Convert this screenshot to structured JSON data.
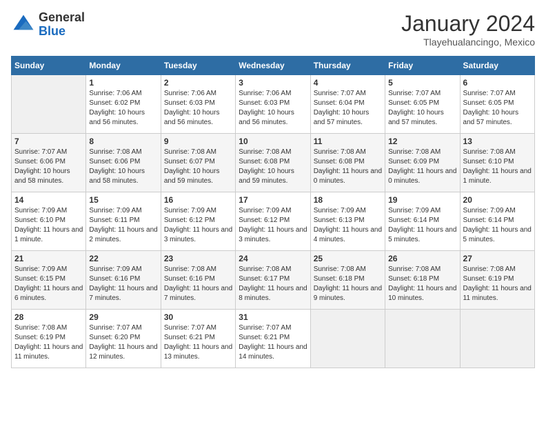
{
  "header": {
    "logo_line1": "General",
    "logo_line2": "Blue",
    "month": "January 2024",
    "location": "Tlayehualancingo, Mexico"
  },
  "days_of_week": [
    "Sunday",
    "Monday",
    "Tuesday",
    "Wednesday",
    "Thursday",
    "Friday",
    "Saturday"
  ],
  "weeks": [
    [
      {
        "day": "",
        "sunrise": "",
        "sunset": "",
        "daylight": ""
      },
      {
        "day": "1",
        "sunrise": "Sunrise: 7:06 AM",
        "sunset": "Sunset: 6:02 PM",
        "daylight": "Daylight: 10 hours and 56 minutes."
      },
      {
        "day": "2",
        "sunrise": "Sunrise: 7:06 AM",
        "sunset": "Sunset: 6:03 PM",
        "daylight": "Daylight: 10 hours and 56 minutes."
      },
      {
        "day": "3",
        "sunrise": "Sunrise: 7:06 AM",
        "sunset": "Sunset: 6:03 PM",
        "daylight": "Daylight: 10 hours and 56 minutes."
      },
      {
        "day": "4",
        "sunrise": "Sunrise: 7:07 AM",
        "sunset": "Sunset: 6:04 PM",
        "daylight": "Daylight: 10 hours and 57 minutes."
      },
      {
        "day": "5",
        "sunrise": "Sunrise: 7:07 AM",
        "sunset": "Sunset: 6:05 PM",
        "daylight": "Daylight: 10 hours and 57 minutes."
      },
      {
        "day": "6",
        "sunrise": "Sunrise: 7:07 AM",
        "sunset": "Sunset: 6:05 PM",
        "daylight": "Daylight: 10 hours and 57 minutes."
      }
    ],
    [
      {
        "day": "7",
        "sunrise": "Sunrise: 7:07 AM",
        "sunset": "Sunset: 6:06 PM",
        "daylight": "Daylight: 10 hours and 58 minutes."
      },
      {
        "day": "8",
        "sunrise": "Sunrise: 7:08 AM",
        "sunset": "Sunset: 6:06 PM",
        "daylight": "Daylight: 10 hours and 58 minutes."
      },
      {
        "day": "9",
        "sunrise": "Sunrise: 7:08 AM",
        "sunset": "Sunset: 6:07 PM",
        "daylight": "Daylight: 10 hours and 59 minutes."
      },
      {
        "day": "10",
        "sunrise": "Sunrise: 7:08 AM",
        "sunset": "Sunset: 6:08 PM",
        "daylight": "Daylight: 10 hours and 59 minutes."
      },
      {
        "day": "11",
        "sunrise": "Sunrise: 7:08 AM",
        "sunset": "Sunset: 6:08 PM",
        "daylight": "Daylight: 11 hours and 0 minutes."
      },
      {
        "day": "12",
        "sunrise": "Sunrise: 7:08 AM",
        "sunset": "Sunset: 6:09 PM",
        "daylight": "Daylight: 11 hours and 0 minutes."
      },
      {
        "day": "13",
        "sunrise": "Sunrise: 7:08 AM",
        "sunset": "Sunset: 6:10 PM",
        "daylight": "Daylight: 11 hours and 1 minute."
      }
    ],
    [
      {
        "day": "14",
        "sunrise": "Sunrise: 7:09 AM",
        "sunset": "Sunset: 6:10 PM",
        "daylight": "Daylight: 11 hours and 1 minute."
      },
      {
        "day": "15",
        "sunrise": "Sunrise: 7:09 AM",
        "sunset": "Sunset: 6:11 PM",
        "daylight": "Daylight: 11 hours and 2 minutes."
      },
      {
        "day": "16",
        "sunrise": "Sunrise: 7:09 AM",
        "sunset": "Sunset: 6:12 PM",
        "daylight": "Daylight: 11 hours and 3 minutes."
      },
      {
        "day": "17",
        "sunrise": "Sunrise: 7:09 AM",
        "sunset": "Sunset: 6:12 PM",
        "daylight": "Daylight: 11 hours and 3 minutes."
      },
      {
        "day": "18",
        "sunrise": "Sunrise: 7:09 AM",
        "sunset": "Sunset: 6:13 PM",
        "daylight": "Daylight: 11 hours and 4 minutes."
      },
      {
        "day": "19",
        "sunrise": "Sunrise: 7:09 AM",
        "sunset": "Sunset: 6:14 PM",
        "daylight": "Daylight: 11 hours and 5 minutes."
      },
      {
        "day": "20",
        "sunrise": "Sunrise: 7:09 AM",
        "sunset": "Sunset: 6:14 PM",
        "daylight": "Daylight: 11 hours and 5 minutes."
      }
    ],
    [
      {
        "day": "21",
        "sunrise": "Sunrise: 7:09 AM",
        "sunset": "Sunset: 6:15 PM",
        "daylight": "Daylight: 11 hours and 6 minutes."
      },
      {
        "day": "22",
        "sunrise": "Sunrise: 7:09 AM",
        "sunset": "Sunset: 6:16 PM",
        "daylight": "Daylight: 11 hours and 7 minutes."
      },
      {
        "day": "23",
        "sunrise": "Sunrise: 7:08 AM",
        "sunset": "Sunset: 6:16 PM",
        "daylight": "Daylight: 11 hours and 7 minutes."
      },
      {
        "day": "24",
        "sunrise": "Sunrise: 7:08 AM",
        "sunset": "Sunset: 6:17 PM",
        "daylight": "Daylight: 11 hours and 8 minutes."
      },
      {
        "day": "25",
        "sunrise": "Sunrise: 7:08 AM",
        "sunset": "Sunset: 6:18 PM",
        "daylight": "Daylight: 11 hours and 9 minutes."
      },
      {
        "day": "26",
        "sunrise": "Sunrise: 7:08 AM",
        "sunset": "Sunset: 6:18 PM",
        "daylight": "Daylight: 11 hours and 10 minutes."
      },
      {
        "day": "27",
        "sunrise": "Sunrise: 7:08 AM",
        "sunset": "Sunset: 6:19 PM",
        "daylight": "Daylight: 11 hours and 11 minutes."
      }
    ],
    [
      {
        "day": "28",
        "sunrise": "Sunrise: 7:08 AM",
        "sunset": "Sunset: 6:19 PM",
        "daylight": "Daylight: 11 hours and 11 minutes."
      },
      {
        "day": "29",
        "sunrise": "Sunrise: 7:07 AM",
        "sunset": "Sunset: 6:20 PM",
        "daylight": "Daylight: 11 hours and 12 minutes."
      },
      {
        "day": "30",
        "sunrise": "Sunrise: 7:07 AM",
        "sunset": "Sunset: 6:21 PM",
        "daylight": "Daylight: 11 hours and 13 minutes."
      },
      {
        "day": "31",
        "sunrise": "Sunrise: 7:07 AM",
        "sunset": "Sunset: 6:21 PM",
        "daylight": "Daylight: 11 hours and 14 minutes."
      },
      {
        "day": "",
        "sunrise": "",
        "sunset": "",
        "daylight": ""
      },
      {
        "day": "",
        "sunrise": "",
        "sunset": "",
        "daylight": ""
      },
      {
        "day": "",
        "sunrise": "",
        "sunset": "",
        "daylight": ""
      }
    ]
  ]
}
